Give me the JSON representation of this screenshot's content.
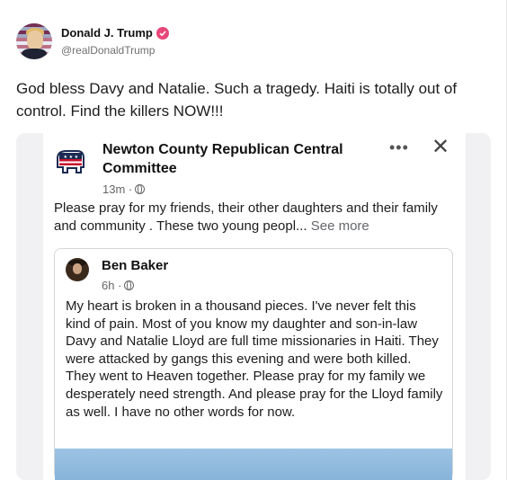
{
  "post": {
    "display_name": "Donald J. Trump",
    "handle": "@realDonaldTrump",
    "verified_icon": "verified-badge-icon",
    "text": "God bless Davy and Natalie. Such a tragedy. Haiti is totally out of control. Find the killers NOW!!!"
  },
  "facebook": {
    "page_name": "Newton County Republican Central Committee",
    "time": "13m ·",
    "body": "Please pray for my friends, their other daughters and their family and community . These two young peopl...",
    "see_more": "See more",
    "more_icon": "•••",
    "close_icon": "✕",
    "shared": {
      "author": "Ben Baker",
      "time": "6h ·",
      "body": "My heart is broken in a thousand pieces. I've never felt this kind of pain. Most of you know my daughter and son-in-law Davy and Natalie Lloyd are full time missionaries in Haiti. They were attacked by gangs this evening and were both killed. They went to Heaven together. Please pray for my family we desperately need strength. And please pray for the Lloyd family as well. I have no other words for now."
    }
  },
  "colors": {
    "verified": "#e8477a",
    "text": "#1c1c1e",
    "muted": "#707072"
  }
}
